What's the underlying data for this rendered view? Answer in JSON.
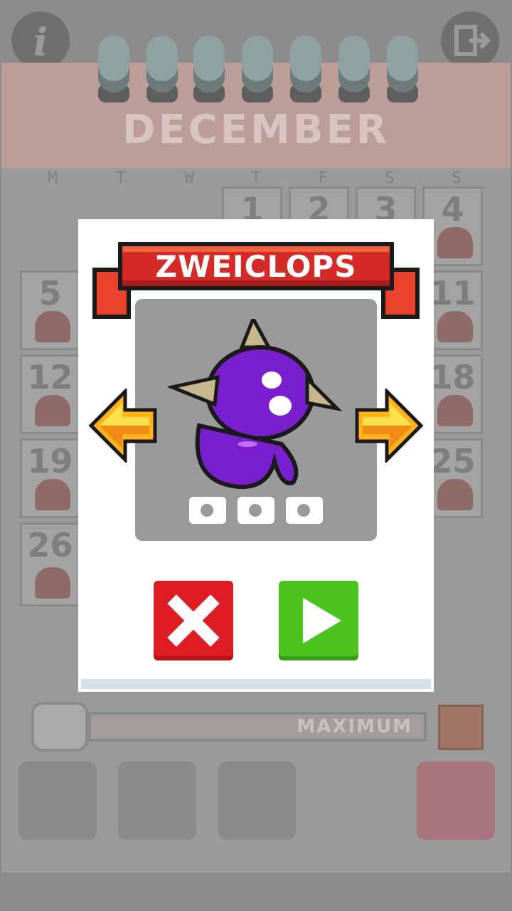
{
  "calendar": {
    "month": "DECEMBER",
    "weekdays": [
      "M",
      "T",
      "W",
      "T",
      "F",
      "S",
      "S"
    ],
    "days": [
      "1",
      "2",
      "3",
      "4",
      "5",
      "11",
      "12",
      "18",
      "19",
      "25",
      "26"
    ]
  },
  "progress": {
    "label": "MAXIMUM"
  },
  "dialog": {
    "monster_name": "ZWEICLOPS",
    "cameras_count": 3
  },
  "icons": {
    "info": "info-icon",
    "exit": "exit-icon",
    "prev": "left-arrow-icon",
    "next": "right-arrow-icon",
    "cancel": "x-icon",
    "play": "play-icon"
  },
  "colors": {
    "cancel": "#df1b23",
    "play": "#4cc31f",
    "banner": "#d42a28",
    "monster": "#7a1fd0",
    "arrow": "#ffb21c"
  }
}
